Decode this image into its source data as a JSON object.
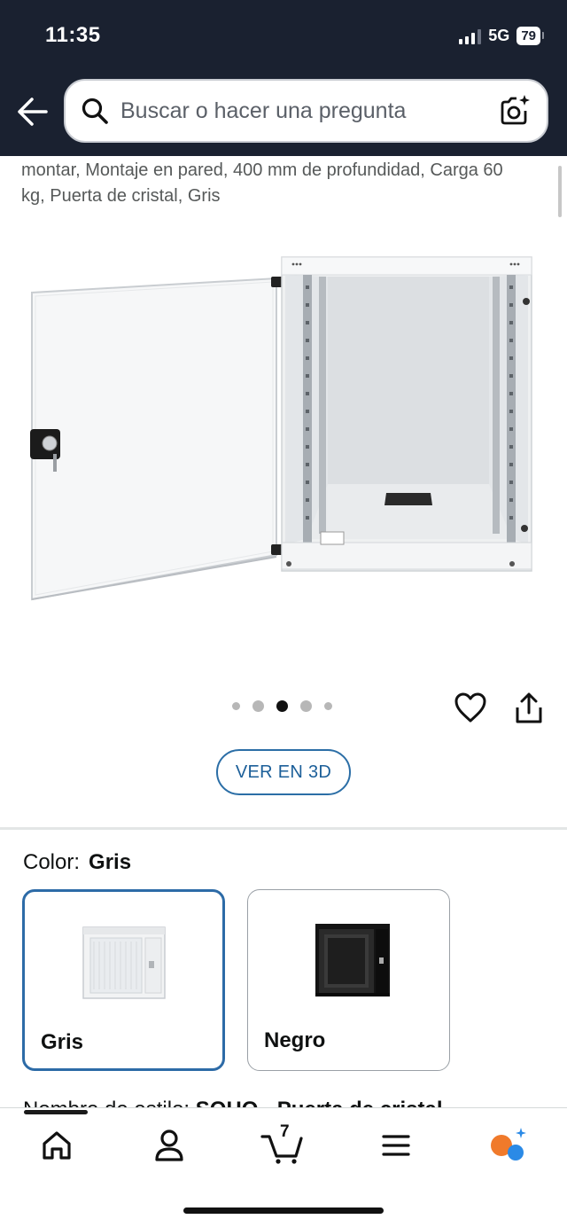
{
  "status_bar": {
    "time": "11:35",
    "network": "5G",
    "battery": "79"
  },
  "header": {
    "search_placeholder": "Buscar o hacer una pregunta",
    "back_icon": "arrow-left-icon",
    "search_icon": "search-icon",
    "camera_icon": "camera-search-icon"
  },
  "product": {
    "title_snippet": "montar, Montaje en pared, 400 mm de profundidad, Carga 60 kg, Puerta de cristal, Gris",
    "image_alt": "wall-mounted network rack cabinet with glass door",
    "carousel": {
      "count": 5,
      "active_index": 2
    },
    "view_3d_label": "VER EN 3D"
  },
  "color_selector": {
    "label": "Color:",
    "selected": "Gris",
    "options": [
      {
        "name": "Gris",
        "selected": true
      },
      {
        "name": "Negro",
        "selected": false
      }
    ]
  },
  "style_line": {
    "label": "Nombre de estilo:",
    "value": "SOHO - Puerta de cristal"
  },
  "bottom_nav": {
    "items": [
      "home",
      "account",
      "cart",
      "menu",
      "rufus"
    ],
    "cart_count": "7"
  },
  "colors": {
    "header_bg": "#1a2130",
    "accent_blue": "#2d6ba7",
    "rufus_orange": "#f07a2b",
    "rufus_blue": "#2b8ae6"
  }
}
